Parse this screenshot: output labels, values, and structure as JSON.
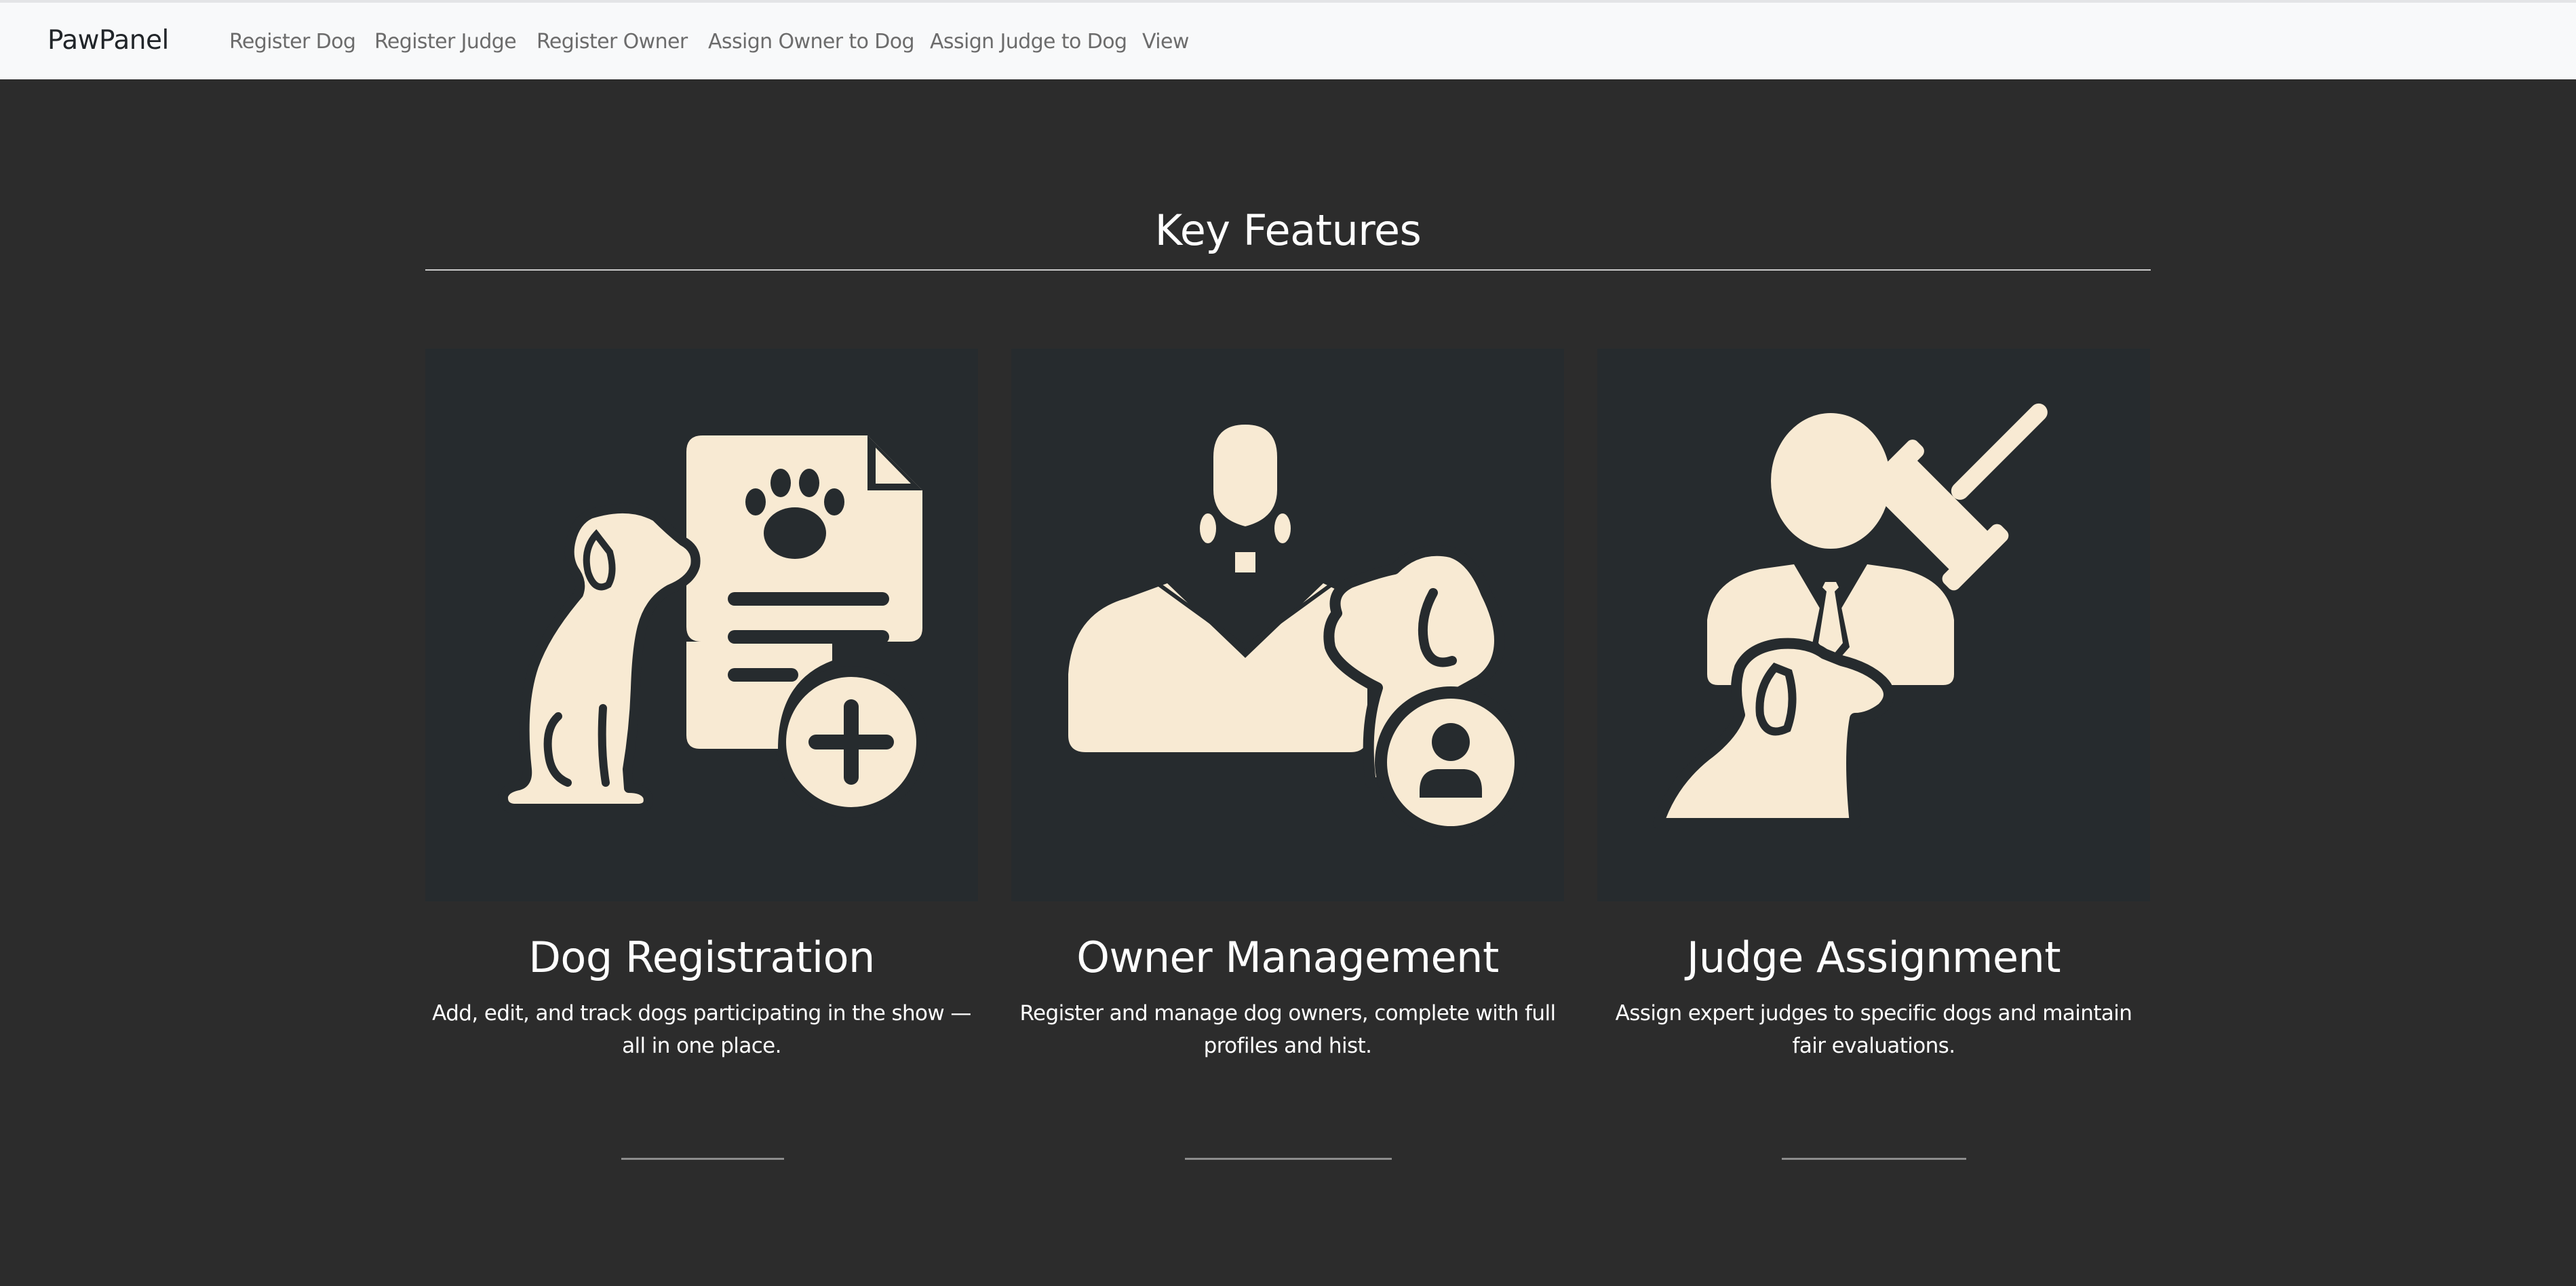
{
  "nav": {
    "brand": "PawPanel",
    "links": [
      {
        "label": "Register Dog"
      },
      {
        "label": "Register Judge"
      },
      {
        "label": "Register Owner"
      },
      {
        "label": "Assign Owner to Dog"
      },
      {
        "label": "Assign Judge to Dog"
      },
      {
        "label": "View"
      }
    ]
  },
  "features": {
    "title": "Key Features",
    "cards": [
      {
        "icon": "dog-registration-icon",
        "title": "Dog Registration",
        "description": "Add, edit, and track dogs participating in the show — all in one place."
      },
      {
        "icon": "owner-management-icon",
        "title": "Owner Management",
        "description": "Register and manage dog owners, complete with full profiles and hist."
      },
      {
        "icon": "judge-assignment-icon",
        "title": "Judge Assignment",
        "description": "Assign expert judges to specific dogs and maintain fair evaluations."
      }
    ]
  },
  "colors": {
    "page_background": "#2c2c2c",
    "card_background": "#262b2e",
    "icon_fill": "#f8ead3",
    "navbar_background": "#f8f9fa"
  }
}
